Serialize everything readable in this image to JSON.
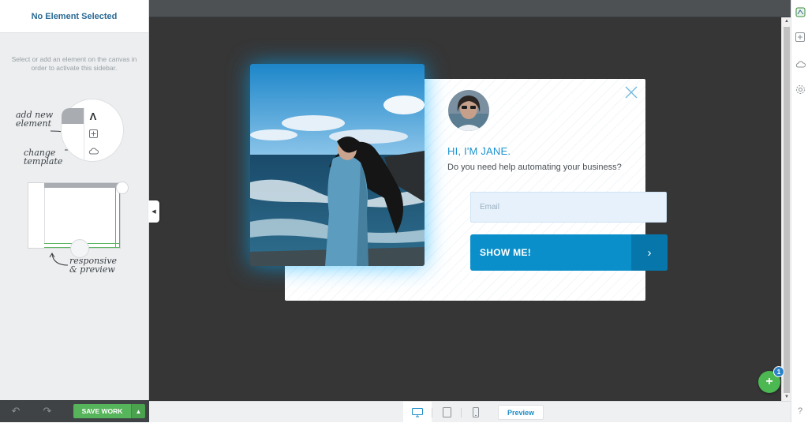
{
  "sidebar": {
    "title": "No Element Selected",
    "hint": "Select or add an element on the canvas in order to activate this sidebar.",
    "tips": {
      "add_element": "add new element",
      "change_template": "change template",
      "responsive": "responsive & preview"
    }
  },
  "footer": {
    "undo_icon": "undo-icon",
    "redo_icon": "redo-icon",
    "save_label": "SAVE WORK"
  },
  "popup": {
    "heading": "HI, I'M JANE.",
    "subtitle": "Do you need help automating your business?",
    "email_placeholder": "Email",
    "cta_label": "SHOW ME!",
    "cta_arrow": "›",
    "accent": "#1c93d1",
    "button_color": "#0a8fcb"
  },
  "device_bar": {
    "devices": [
      "desktop",
      "tablet",
      "mobile"
    ],
    "active_device": "desktop",
    "preview_label": "Preview"
  },
  "fab": {
    "label": "+",
    "badge": "1"
  },
  "colors": {
    "canvas": "#363636",
    "save_green": "#56b45a",
    "brand_blue": "#2a6a94"
  }
}
